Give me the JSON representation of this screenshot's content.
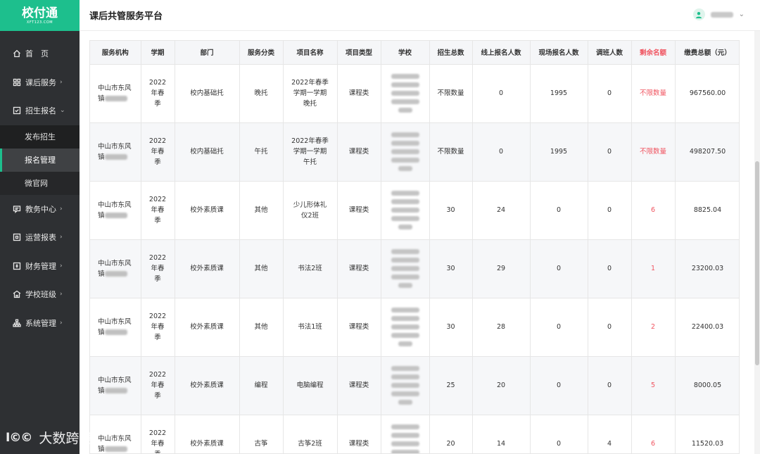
{
  "brand": {
    "name": "校付通",
    "sub": "XFT123.COM"
  },
  "header": {
    "title": "课后共管服务平台"
  },
  "sidebar": {
    "items": [
      {
        "label": "首　页",
        "icon": "home-icon",
        "chevron": ""
      },
      {
        "label": "课后服务",
        "icon": "grid-icon",
        "chevron": "›"
      },
      {
        "label": "招生报名",
        "icon": "check-square-icon",
        "chevron": "⌄"
      },
      {
        "label": "教务中心",
        "icon": "chat-icon",
        "chevron": "›"
      },
      {
        "label": "运营报表",
        "icon": "report-icon",
        "chevron": "›"
      },
      {
        "label": "财务管理",
        "icon": "finance-icon",
        "chevron": "›"
      },
      {
        "label": "学校班级",
        "icon": "school-icon",
        "chevron": "›"
      },
      {
        "label": "系统管理",
        "icon": "org-icon",
        "chevron": "›"
      }
    ],
    "subitems": [
      {
        "label": "发布招生"
      },
      {
        "label": "报名管理"
      },
      {
        "label": "微官网"
      }
    ]
  },
  "table": {
    "headers": [
      "服务机构",
      "学期",
      "部门",
      "服务分类",
      "项目名称",
      "项目类型",
      "学校",
      "招生总数",
      "线上报名人数",
      "现场报名人数",
      "调班人数",
      "剩余名额",
      "缴费总额（元）"
    ],
    "org_prefix": "中山市东风",
    "org_suffix_prefix": "镇",
    "rows": [
      {
        "term": [
          "2022",
          "年春",
          "季"
        ],
        "dept": "校内基础托",
        "category": "晚托",
        "project": [
          "2022年春季",
          "学期一学期",
          "晚托"
        ],
        "type": "课程类",
        "total": "不限数量",
        "online": "0",
        "onsite": "1995",
        "transfer": "0",
        "remaining": "不限数量",
        "fee": "967560.00"
      },
      {
        "term": [
          "2022",
          "年春",
          "季"
        ],
        "dept": "校内基础托",
        "category": "午托",
        "project": [
          "2022年春季",
          "学期一学期",
          "午托"
        ],
        "type": "课程类",
        "total": "不限数量",
        "online": "0",
        "onsite": "1995",
        "transfer": "0",
        "remaining": "不限数量",
        "fee": "498207.50"
      },
      {
        "term": [
          "2022",
          "年春",
          "季"
        ],
        "dept": "校外素质课",
        "category": "其他",
        "project": [
          "少儿形体礼",
          "仪2班"
        ],
        "type": "课程类",
        "total": "30",
        "online": "24",
        "onsite": "0",
        "transfer": "0",
        "remaining": "6",
        "fee": "8825.04"
      },
      {
        "term": [
          "2022",
          "年春",
          "季"
        ],
        "dept": "校外素质课",
        "category": "其他",
        "project": [
          "书法2班"
        ],
        "type": "课程类",
        "total": "30",
        "online": "29",
        "onsite": "0",
        "transfer": "0",
        "remaining": "1",
        "fee": "23200.03"
      },
      {
        "term": [
          "2022",
          "年春",
          "季"
        ],
        "dept": "校外素质课",
        "category": "其他",
        "project": [
          "书法1班"
        ],
        "type": "课程类",
        "total": "30",
        "online": "28",
        "onsite": "0",
        "transfer": "0",
        "remaining": "2",
        "fee": "22400.03"
      },
      {
        "term": [
          "2022",
          "年春",
          "季"
        ],
        "dept": "校外素质课",
        "category": "编程",
        "project": [
          "电脑编程"
        ],
        "type": "课程类",
        "total": "25",
        "online": "20",
        "onsite": "0",
        "transfer": "0",
        "remaining": "5",
        "fee": "8000.05"
      },
      {
        "term": [
          "2022",
          "年春",
          "季"
        ],
        "dept": "校外素质课",
        "category": "古筝",
        "project": [
          "古筝2班"
        ],
        "type": "课程类",
        "total": "20",
        "online": "14",
        "onsite": "0",
        "transfer": "4",
        "remaining": "6",
        "fee": "11520.03"
      }
    ]
  },
  "watermark": {
    "logo": "I©©",
    "text": "大数跨境"
  },
  "colors": {
    "accent": "#1dbf8d",
    "sidebar": "#2e3033",
    "highlight_red": "#f05561"
  }
}
